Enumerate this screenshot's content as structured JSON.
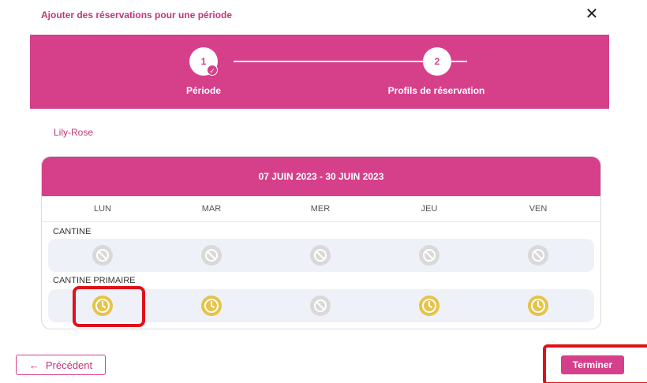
{
  "dialog": {
    "title": "Ajouter des réservations pour une période",
    "close_icon": "close-icon"
  },
  "stepper": {
    "steps": [
      {
        "number": "1",
        "label": "Période",
        "status": "completed"
      },
      {
        "number": "2",
        "label": "Profils de réservation",
        "status": "active"
      }
    ],
    "check_icon": "check-icon"
  },
  "child": {
    "name": "Lily-Rose"
  },
  "calendar": {
    "period": "07 JUIN 2023 - 30 JUIN 2023",
    "days": [
      "LUN",
      "MAR",
      "MER",
      "JEU",
      "VEN"
    ],
    "sections": [
      {
        "label": "CANTINE",
        "slots": [
          "unavailable",
          "unavailable",
          "unavailable",
          "unavailable",
          "unavailable"
        ]
      },
      {
        "label": "CANTINE PRIMAIRE",
        "slots": [
          "pending",
          "pending",
          "unavailable",
          "pending",
          "pending"
        ]
      }
    ]
  },
  "colors": {
    "brand": "#d6408a",
    "pending": "#e6c34a",
    "unavailable": "#d9d9d9",
    "highlight": "#e0101a"
  },
  "footer": {
    "previous_label": "Précédent",
    "previous_icon": "arrow-left-icon",
    "finish_label": "Terminer"
  }
}
